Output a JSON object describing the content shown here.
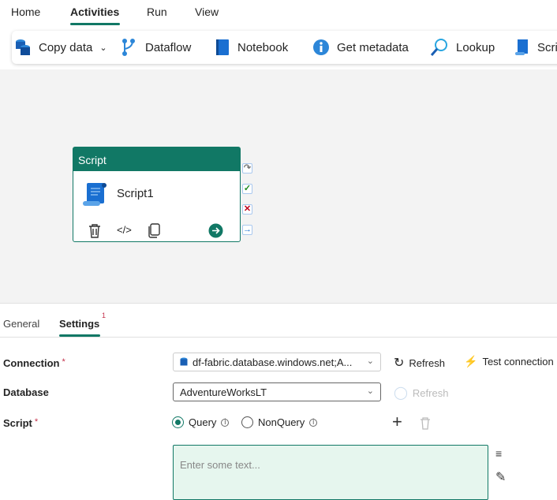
{
  "menu_tabs": [
    {
      "label": "Home"
    },
    {
      "label": "Activities"
    },
    {
      "label": "Run"
    },
    {
      "label": "View"
    }
  ],
  "toolbar": [
    {
      "label": "Copy data",
      "icon": "database-icon"
    },
    {
      "label": "Dataflow",
      "icon": "dataflow-icon"
    },
    {
      "label": "Notebook",
      "icon": "notebook-icon"
    },
    {
      "label": "Get metadata",
      "icon": "info-icon"
    },
    {
      "label": "Lookup",
      "icon": "search-icon"
    },
    {
      "label": "Script",
      "icon": "script-icon"
    }
  ],
  "node": {
    "type": "Script",
    "name": "Script1"
  },
  "panel": {
    "tabs": [
      {
        "label": "General"
      },
      {
        "label": "Settings",
        "badge": "1"
      }
    ],
    "connection": {
      "label": "Connection",
      "required": "*",
      "value": "df-fabric.database.windows.net;A...",
      "refresh": "Refresh",
      "test": "Test connection"
    },
    "database": {
      "label": "Database",
      "value": "AdventureWorksLT",
      "refresh": "Refresh"
    },
    "script": {
      "label": "Script",
      "required": "*",
      "options": [
        "Query",
        "NonQuery"
      ],
      "selected": "Query",
      "placeholder": "Enter some text..."
    }
  },
  "colors": {
    "accent": "#117865",
    "required": "#c4314b",
    "editor_bg": "#e6f6ee"
  }
}
